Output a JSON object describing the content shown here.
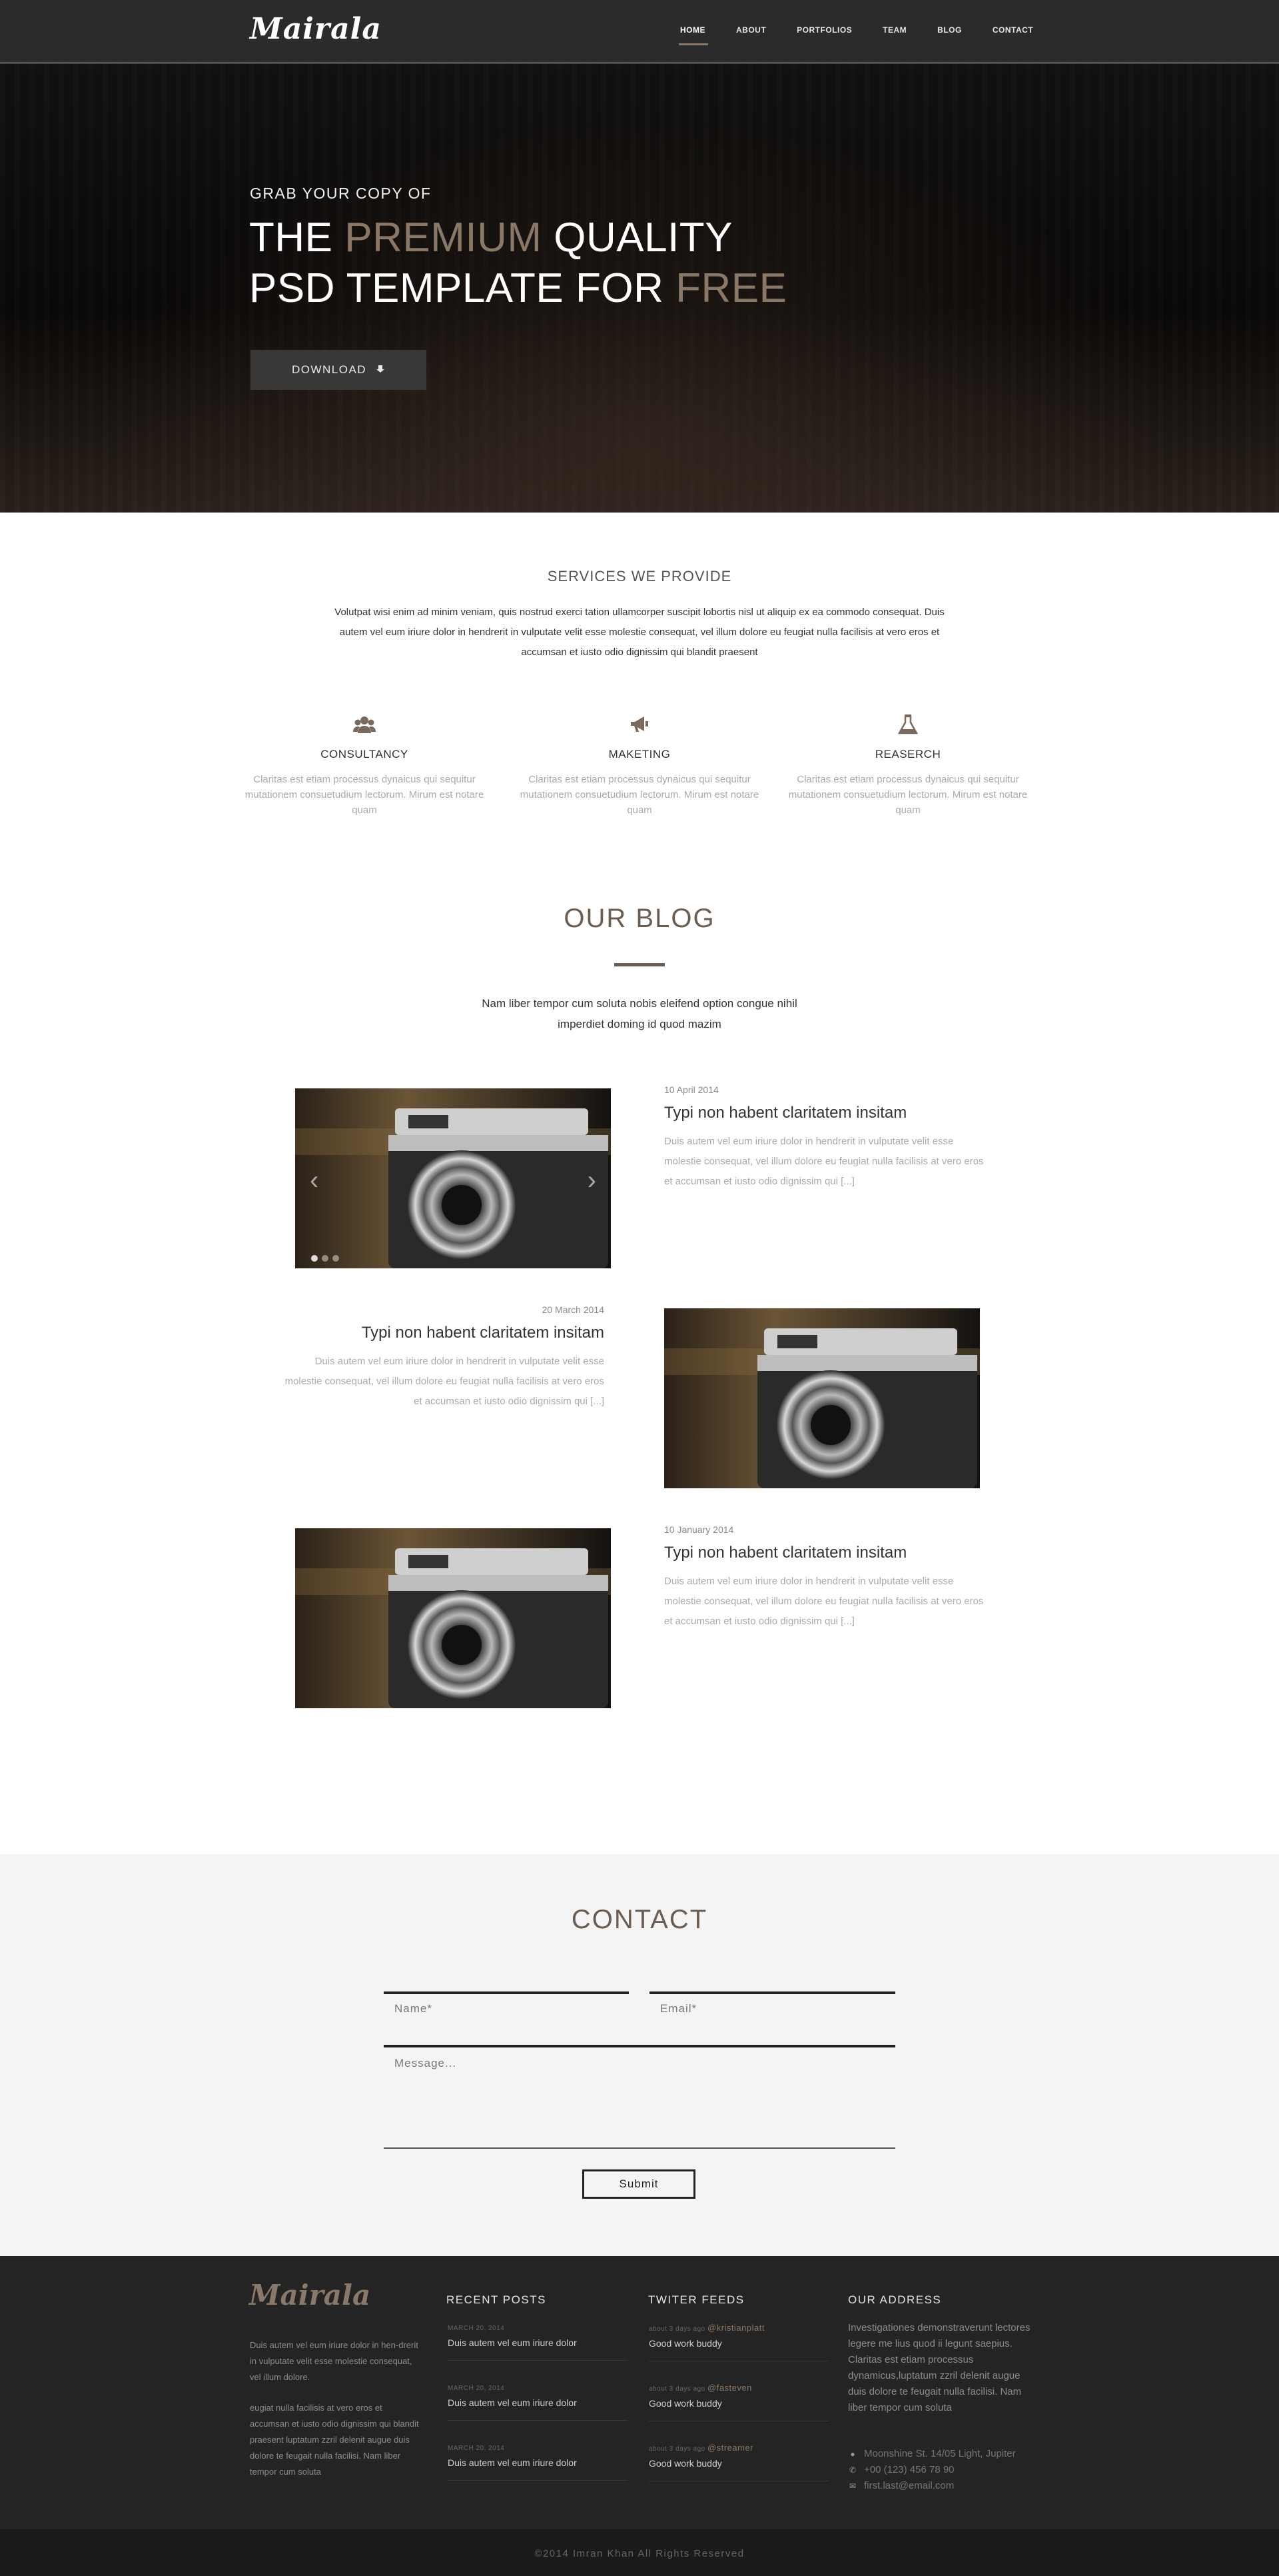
{
  "header": {
    "logo": "Mairala",
    "nav": [
      "HOME",
      "ABOUT",
      "PORTFOLIOS",
      "TEAM",
      "BLOG",
      "CONTACT"
    ],
    "active": "HOME"
  },
  "hero": {
    "subtitle": "GRAB YOUR COPY OF",
    "line1_a": "THE ",
    "line1_hl": "PREMIUM",
    "line1_b": " QUALITY",
    "line2_a": "PSD TEMPLATE FOR ",
    "line2_hl": "FREE",
    "download_label": "DOWNLOAD",
    "download_icon": "download-icon"
  },
  "services": {
    "title": "SERVICES WE PROVIDE",
    "description": "Volutpat wisi enim ad minim veniam, quis nostrud exerci tation ullamcorper suscipit lobortis nisl ut aliquip ex ea commodo consequat. Duis autem vel eum iriure dolor in hendrerit in vulputate velit esse molestie consequat, vel illum dolore eu feugiat nulla facilisis at vero eros et accumsan et iusto odio dignissim qui blandit praesent",
    "items": [
      {
        "icon": "users-icon",
        "title": "CONSULTANCY",
        "text": "Claritas est etiam processus dynaicus qui sequitur mutationem consuetudium lectorum. Mirum est notare quam"
      },
      {
        "icon": "megaphone-icon",
        "title": "MAKETING",
        "text": "Claritas est etiam processus dynaicus qui sequitur mutationem consuetudium lectorum. Mirum est notare quam"
      },
      {
        "icon": "flask-icon",
        "title": "REASERCH",
        "text": "Claritas est etiam processus dynaicus qui sequitur mutationem consuetudium lectorum. Mirum est notare quam"
      }
    ]
  },
  "blog": {
    "title": "OUR BLOG",
    "description": "Nam liber tempor cum soluta nobis eleifend option congue nihil imperdiet doming id quod mazim",
    "posts": [
      {
        "date": "10 April 2014",
        "title": "Typi non habent claritatem insitam",
        "text": "Duis autem vel eum iriure dolor in hendrerit in vulputate velit esse molestie consequat, vel illum dolore eu feugiat nulla facilisis at vero eros et accumsan et iusto odio dignissim qui [...]"
      },
      {
        "date": "20 March 2014",
        "title": "Typi non habent claritatem insitam",
        "text": "Duis autem vel eum iriure dolor in hendrerit in vulputate velit esse molestie consequat, vel illum dolore eu feugiat nulla facilisis at vero eros et accumsan et iusto odio dignissim qui [...]"
      },
      {
        "date": "10 January 2014",
        "title": "Typi non habent claritatem insitam",
        "text": "Duis autem vel eum iriure dolor in hendrerit in vulputate velit esse molestie consequat, vel illum dolore eu feugiat nulla facilisis at vero eros et accumsan et iusto odio dignissim qui [...]"
      }
    ]
  },
  "contact": {
    "title": "CONTACT",
    "name_placeholder": "Name*",
    "email_placeholder": "Email*",
    "message_placeholder": "Message...",
    "submit_label": "Submit"
  },
  "footer": {
    "logo": "Mairala",
    "about_1": "Duis autem vel eum iriure dolor in hen-drerit in vulputate velit esse molestie consequat, vel illum dolore.",
    "about_2": "eugiat nulla facilisis at vero eros et accumsan et iusto odio dignissim qui blandit praesent luptatum zzril delenit augue duis dolore te feugait nulla facilisi. Nam liber tempor cum soluta",
    "recent_title": "RECENT POSTS",
    "recent_posts": [
      {
        "date": "MARCH 20, 2014",
        "title": "Duis autem vel eum iriure dolor"
      },
      {
        "date": "MARCH 20, 2014",
        "title": "Duis autem vel eum iriure dolor"
      },
      {
        "date": "MARCH 20, 2014",
        "title": "Duis autem vel eum iriure dolor"
      }
    ],
    "twitter_title": "TWITER FEEDS",
    "tweets": [
      {
        "when": "about 3 days ago",
        "handle": "@kristianplatt",
        "text": "Good work buddy"
      },
      {
        "when": "about 3 days ago",
        "handle": "@fasteven",
        "text": "Good work buddy"
      },
      {
        "when": "about 3 days ago",
        "handle": "@streamer",
        "text": "Good work buddy"
      }
    ],
    "address_title": "OUR ADDRESS",
    "address_text": "Investigationes demonstraverunt lectores legere me lius quod ii legunt saepius. Claritas est etiam processus dynamicus,luptatum zzril delenit augue duis dolore te feugait nulla facilisi. Nam liber tempor cum soluta",
    "location": "Moonshine St. 14/05 Light, Jupiter",
    "phone": "+00 (123) 456 78 90",
    "email": "first.last@email.com",
    "copyright": "©2014 Imran Khan All Rights Reserved"
  }
}
